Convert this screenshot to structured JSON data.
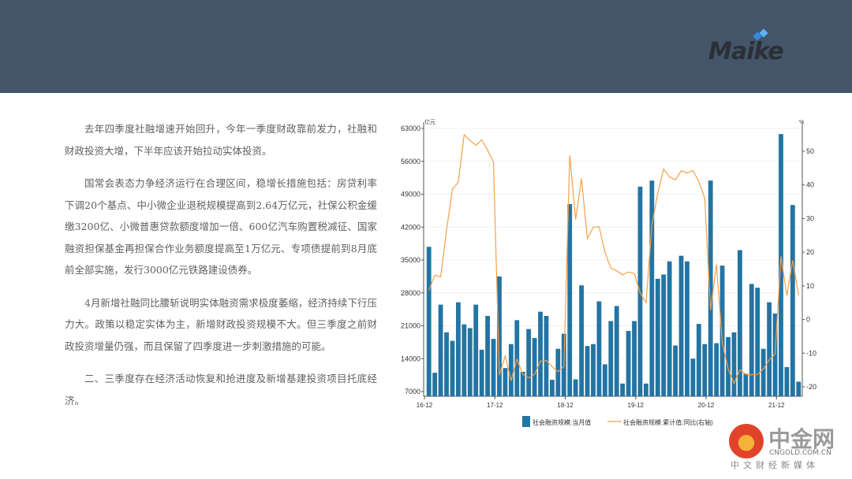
{
  "header": {
    "logo_text": "Maike"
  },
  "paragraphs": [
    "去年四季度社融增速开始回升，今年一季度财政靠前发力，社融和财政投资大增，下半年应该开始拉动实体投资。",
    "国常会表态力争经济运行在合理区间，稳增长措施包括：房贷利率下调20个基点、中小微企业退税规模提高到2.64万亿元，社保公积金缓缴3200亿、小微普惠贷款额度增加一倍、600亿汽车购置税减征、国家融资担保基金再担保合作业务额度提高至1万亿元、专项债提前到8月底前全部实施，发行3000亿元铁路建设债券。",
    "4月新增社融同比腰斩说明实体融资需求极度萎缩，经济持续下行压力大。政策以稳定实体为主，新增财政投资规模不大。但三季度之前财政投资增量仍强，而且保留了四季度进一步刺激措施的可能。",
    "二、三季度存在经济活动恢复和抢进度及新增基建投资项目托底经济。"
  ],
  "watermark": {
    "name": "中金网",
    "url": "CNGOLD.COM.CN",
    "tagline": "中文财经新媒体"
  },
  "chart_data": {
    "type": "bar",
    "title": "",
    "ylabel": "亿元",
    "y2label": "%",
    "ylim": [
      7000,
      63000
    ],
    "y2lim": [
      -20,
      50
    ],
    "yticks": [
      "63000",
      "56000",
      "49000",
      "42000",
      "35000",
      "28000",
      "21000",
      "14000",
      "7000"
    ],
    "y2ticks": [
      "50",
      "40",
      "30",
      "20",
      "10",
      "0",
      "-10",
      "-20"
    ],
    "xticks": [
      {
        "index": 0,
        "label": "16-12"
      },
      {
        "index": 12,
        "label": "17-12"
      },
      {
        "index": 24,
        "label": "18-12"
      },
      {
        "index": 36,
        "label": "19-12"
      },
      {
        "index": 48,
        "label": "20-12"
      },
      {
        "index": 60,
        "label": "21-12"
      }
    ],
    "colors": {
      "bar": "#2374a3",
      "line": "#f5a04a"
    },
    "series": [
      {
        "name": "社会融资规模:当月值",
        "type": "bar",
        "axis": "left",
        "values": [
          37800,
          11000,
          25500,
          19600,
          17800,
          26000,
          21300,
          20500,
          25500,
          15900,
          23100,
          18200,
          31500,
          12000,
          17100,
          22200,
          11200,
          20300,
          18400,
          24000,
          23100,
          9500,
          16100,
          19300,
          46900,
          9600,
          29600,
          16700,
          17100,
          26200,
          12800,
          22000,
          25200,
          8700,
          19900,
          22000,
          50600,
          8700,
          51900,
          31000,
          31900,
          34700,
          16800,
          35900,
          34700,
          14000,
          21400,
          17100,
          51900,
          17300,
          33800,
          18600,
          19600,
          37100,
          10800,
          29900,
          29100,
          16100,
          26000,
          23600,
          61800,
          12200,
          46700,
          9100
        ]
      },
      {
        "name": "社会融资规模:累计值:同比(右轴)",
        "type": "line",
        "axis": "right",
        "values": [
          8.7,
          13.2,
          12.7,
          26.6,
          38.7,
          40.8,
          54.9,
          53.2,
          51.8,
          53.4,
          50.3,
          46.8,
          -16.5,
          -10.8,
          -18.2,
          -11.8,
          -16.3,
          -17.3,
          -16.3,
          -12.4,
          -12.2,
          -14,
          -15.5,
          -14,
          48.8,
          29.7,
          41.9,
          24.1,
          27.4,
          27.6,
          20,
          15.3,
          14.5,
          13.3,
          14.1,
          13.7,
          7.9,
          5,
          28.1,
          37.5,
          44.7,
          42.4,
          41.5,
          44.2,
          43.6,
          44.3,
          41,
          36.1,
          2.8,
          16.4,
          -6.9,
          -14.7,
          -19,
          -14.9,
          -16.3,
          -16.4,
          -16.3,
          -14.7,
          -12,
          -10.2,
          18.8,
          7.1,
          17.6,
          7.2
        ]
      }
    ],
    "legend": "bottom"
  }
}
